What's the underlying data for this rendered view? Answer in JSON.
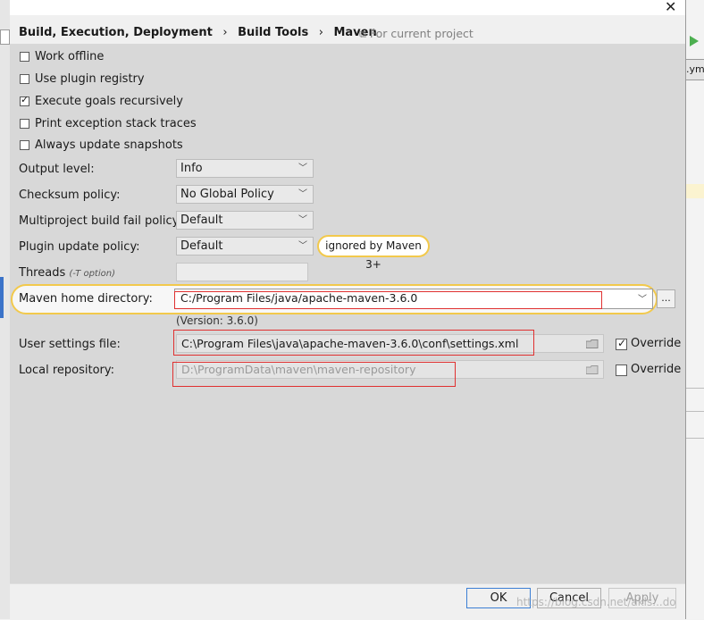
{
  "breadcrumb": {
    "part1": "Build, Execution, Deployment",
    "sep1": "›",
    "part2": "Build Tools",
    "sep2": "›",
    "part3": "Maven",
    "scope": "For current project"
  },
  "checkboxes": [
    {
      "label": "Work offline",
      "checked": false
    },
    {
      "label": "Use plugin registry",
      "checked": false
    },
    {
      "label": "Execute goals recursively",
      "checked": true
    },
    {
      "label": "Print exception stack traces",
      "checked": false
    },
    {
      "label": "Always update snapshots",
      "checked": false
    }
  ],
  "output_level": {
    "label": "Output level:",
    "value": "Info"
  },
  "checksum_policy": {
    "label": "Checksum policy:",
    "value": "No Global Policy"
  },
  "multiproject_fail": {
    "label": "Multiproject build fail policy:",
    "value": "Default"
  },
  "plugin_update": {
    "label": "Plugin update policy:",
    "value": "Default",
    "note": "ignored by Maven 3+"
  },
  "threads": {
    "label": "Threads",
    "hint": "(-T option)",
    "value": ""
  },
  "maven_home": {
    "label": "Maven home directory:",
    "value": "C:/Program Files/java/apache-maven-3.6.0",
    "browse": "...",
    "version": "(Version: 3.6.0)"
  },
  "user_settings": {
    "label": "User settings file:",
    "value": "C:\\Program Files\\java\\apache-maven-3.6.0\\conf\\settings.xml",
    "override_label": "Override",
    "override_checked": true
  },
  "local_repo": {
    "label": "Local repository:",
    "value": "D:\\ProgramData\\maven\\maven-repository",
    "override_label": "Override",
    "override_checked": false
  },
  "buttons": {
    "ok": "OK",
    "cancel": "Cancel",
    "apply": "Apply"
  },
  "right_pane": {
    "tab_text": ".ym"
  },
  "watermark": "https://blog.csdn.net/akls...do",
  "colors": {
    "highlight": "#f2c94c",
    "content_bg": "#d8d8d8",
    "red_box": "#e03030"
  }
}
